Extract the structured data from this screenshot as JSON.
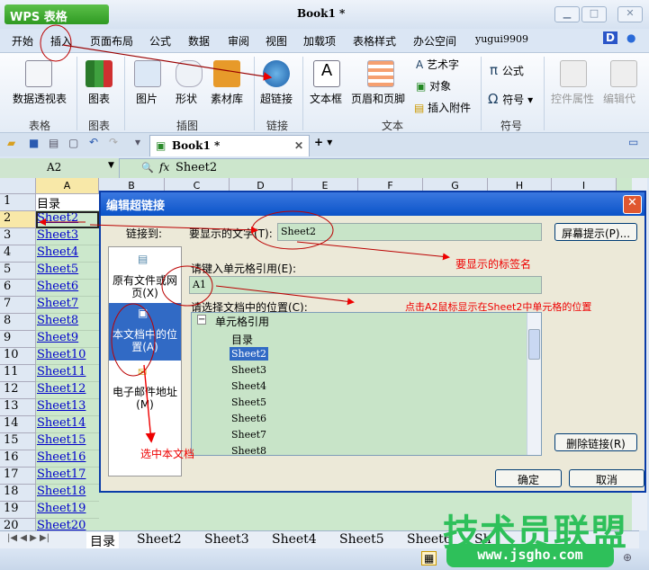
{
  "app": {
    "brand": "WPS 表格",
    "title": "Book1 *"
  },
  "menu": [
    "开始",
    "插入",
    "页面布局",
    "公式",
    "数据",
    "审阅",
    "视图",
    "加载项",
    "表格样式",
    "办公空间"
  ],
  "user": "yugui9909",
  "ribbon": {
    "buttons": [
      "数据透视表",
      "图表",
      "图片",
      "形状",
      "素材库",
      "超链接",
      "文本框",
      "页眉和页脚",
      "控件属性",
      "编辑代"
    ],
    "small": [
      "艺术字",
      "对象",
      "插入附件",
      "公式",
      "符号"
    ],
    "groups": [
      "表格",
      "图表",
      "插图",
      "链接",
      "文本",
      "符号"
    ]
  },
  "booktab": "Book1 *",
  "namebox": "A2",
  "formula": "Sheet2",
  "columns": [
    "A",
    "B",
    "C",
    "D",
    "E",
    "F",
    "G",
    "H",
    "I"
  ],
  "rows": [
    "目录",
    "Sheet2",
    "Sheet3",
    "Sheet4",
    "Sheet5",
    "Sheet6",
    "Sheet7",
    "Sheet8",
    "Sheet9",
    "Sheet10",
    "Sheet11",
    "Sheet12",
    "Sheet13",
    "Sheet14",
    "Sheet15",
    "Sheet16",
    "Sheet17",
    "Sheet18",
    "Sheet19",
    "Sheet20"
  ],
  "sheettabs": [
    "目录",
    "Sheet2",
    "Sheet3",
    "Sheet4",
    "Sheet5",
    "Sheet6",
    "Sh"
  ],
  "dialog": {
    "title": "编辑超链接",
    "link_to": "链接到:",
    "display_label": "要显示的文字(T):",
    "display_value": "Sheet2",
    "screentip": "屏幕提示(P)...",
    "cellref_label": "请键入单元格引用(E):",
    "cellref_value": "A1",
    "location_label": "请选择文档中的位置(C):",
    "left": [
      "原有文件或网页(X)",
      "本文档中的位置(A)",
      "电子邮件地址(M)"
    ],
    "tree_root": "单元格引用",
    "tree": [
      "目录",
      "Sheet2",
      "Sheet3",
      "Sheet4",
      "Sheet5",
      "Sheet6",
      "Sheet7",
      "Sheet8"
    ],
    "remove": "删除链接(R)",
    "ok": "确定",
    "cancel": "取消"
  },
  "notes": [
    "要显示的标签名",
    "点击A2鼠标显示在Sheet2中单元格的位置",
    "选中本文档"
  ],
  "watermark": {
    "name": "技术员联盟",
    "url": "www.jsgho.com"
  },
  "colors": {
    "annotation": "#e00000",
    "dialog_title": "#0b53c8",
    "cell_fill": "#cce8cc"
  }
}
